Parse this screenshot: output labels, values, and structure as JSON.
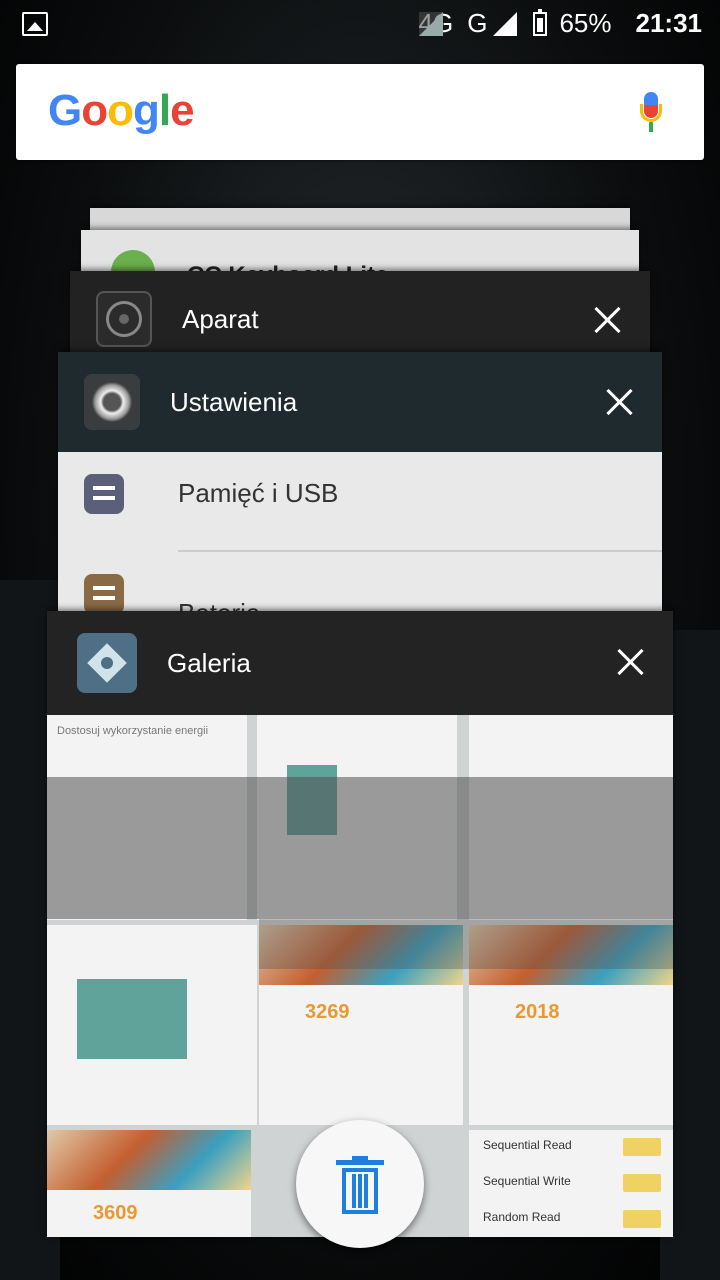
{
  "status": {
    "network1": "4G",
    "network2": "G",
    "battery": "65%",
    "time": "21:31"
  },
  "search": {
    "logo": "Google"
  },
  "cards": {
    "back_partial": {
      "title": "CC Keyboard Lite"
    },
    "aparat": {
      "title": "Aparat"
    },
    "ustawienia": {
      "title": "Ustawienia",
      "items": [
        {
          "label": "Pamięć i USB"
        },
        {
          "label": "Bateria"
        }
      ]
    },
    "galeria": {
      "title": "Galeria",
      "scores": [
        "3269",
        "2018",
        "3609"
      ],
      "seq_read": "Sequential Read",
      "seq_write": "Sequential Write",
      "random_read": "Random Read"
    }
  },
  "actions": {
    "clear_all": "trash-icon"
  }
}
